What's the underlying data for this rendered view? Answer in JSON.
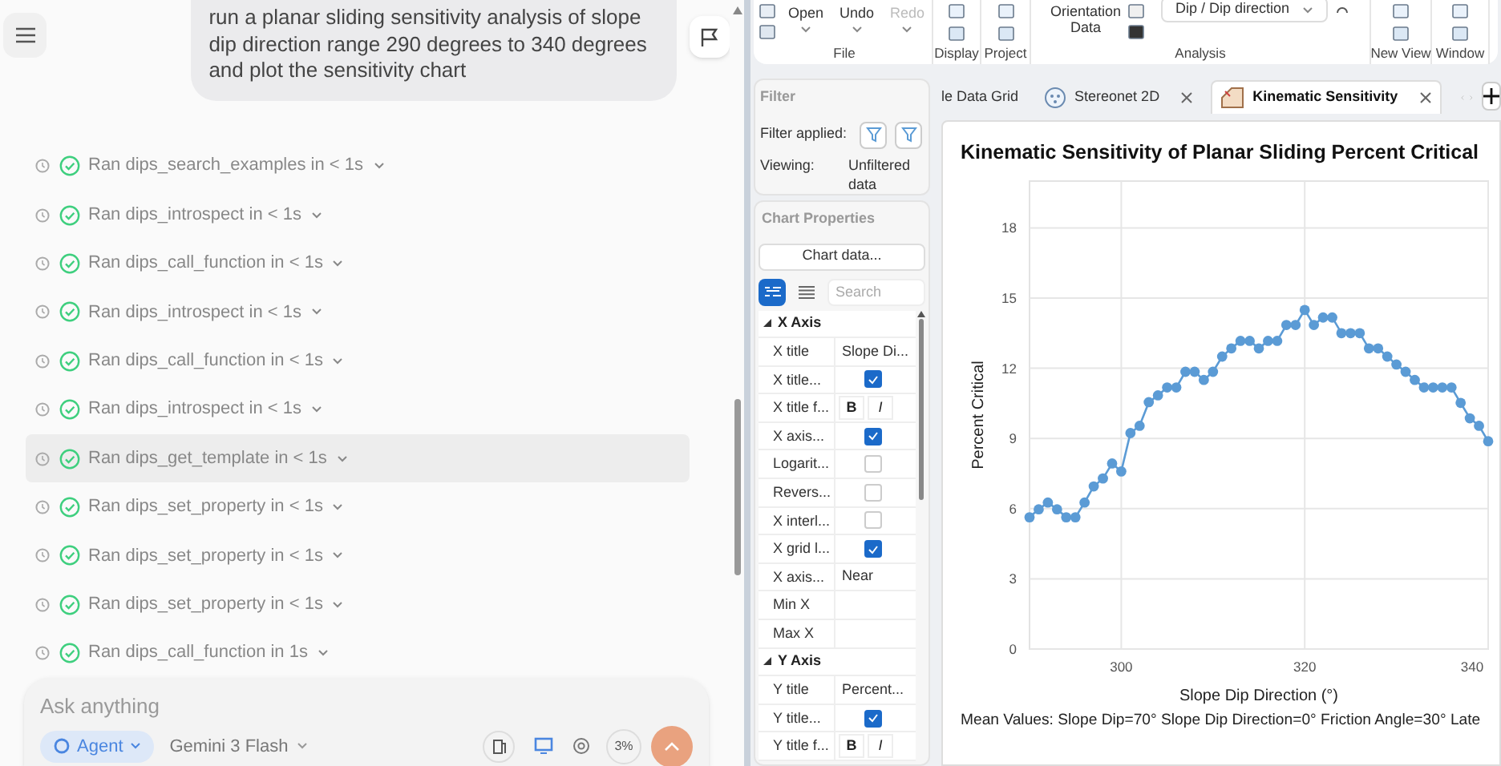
{
  "chat": {
    "user_message": "run a planar sliding sensitivity analysis of slope dip direction range 290 degrees to 340 degrees and plot the sensitivity chart",
    "tool_runs": [
      {
        "text": "Ran dips_search_examples in < 1s",
        "hovered": false
      },
      {
        "text": "Ran dips_introspect in < 1s",
        "hovered": false
      },
      {
        "text": "Ran dips_call_function in < 1s",
        "hovered": false
      },
      {
        "text": "Ran dips_introspect in < 1s",
        "hovered": false
      },
      {
        "text": "Ran dips_call_function in < 1s",
        "hovered": false
      },
      {
        "text": "Ran dips_introspect in < 1s",
        "hovered": false
      },
      {
        "text": "Ran dips_get_template in < 1s",
        "hovered": true
      },
      {
        "text": "Ran dips_set_property in < 1s",
        "hovered": false
      },
      {
        "text": "Ran dips_set_property in < 1s",
        "hovered": false
      },
      {
        "text": "Ran dips_set_property in < 1s",
        "hovered": false
      },
      {
        "text": "Ran dips_call_function in 1s",
        "hovered": false
      }
    ],
    "input": {
      "placeholder": "Ask anything",
      "mode": "Agent",
      "model": "Gemini 3 Flash",
      "context_usage": "3%"
    }
  },
  "ribbon": {
    "groups": [
      {
        "label": "File",
        "items": [
          {
            "label": "Open",
            "disabled": false
          },
          {
            "label": "Undo",
            "disabled": false
          },
          {
            "label": "Redo",
            "disabled": true
          }
        ]
      },
      {
        "label": "Display"
      },
      {
        "label": "Project"
      },
      {
        "label": "Analysis",
        "button": "Orientation Data",
        "select": "Dip / Dip direction"
      },
      {
        "label": "New View"
      },
      {
        "label": "Window"
      }
    ]
  },
  "filter": {
    "title": "Filter",
    "applied_label": "Filter applied:",
    "viewing_label": "Viewing:",
    "viewing_value": "Unfiltered data"
  },
  "chart_properties": {
    "title": "Chart Properties",
    "chart_data_button": "Chart data...",
    "search_placeholder": "Search",
    "view_modes": [
      {
        "kind": "categorized",
        "selected": true
      },
      {
        "kind": "list",
        "selected": false
      }
    ],
    "rows": [
      {
        "kind": "section",
        "label": "X Axis",
        "expanded": true
      },
      {
        "kind": "text",
        "label": "X title",
        "value": "Slope Di..."
      },
      {
        "kind": "checkbox",
        "label": "X title...",
        "checked": true
      },
      {
        "kind": "font",
        "label": "X title f...",
        "bold": "B",
        "italic": "I"
      },
      {
        "kind": "checkbox",
        "label": "X axis...",
        "checked": true
      },
      {
        "kind": "checkbox",
        "label": "Logarit...",
        "checked": false
      },
      {
        "kind": "checkbox",
        "label": "Revers...",
        "checked": false
      },
      {
        "kind": "checkbox",
        "label": "X interl...",
        "checked": false
      },
      {
        "kind": "checkbox",
        "label": "X grid l...",
        "checked": true
      },
      {
        "kind": "text",
        "label": "X axis...",
        "value": "Near"
      },
      {
        "kind": "text",
        "label": "Min X"
      },
      {
        "kind": "text",
        "label": "Max X"
      },
      {
        "kind": "section",
        "label": "Y Axis",
        "expanded": true
      },
      {
        "kind": "text",
        "label": "Y title",
        "value": "Percent..."
      },
      {
        "kind": "checkbox",
        "label": "Y title...",
        "checked": true
      },
      {
        "kind": "font",
        "label": "Y title f...",
        "bold": "B",
        "italic": "I"
      }
    ]
  },
  "tabs": [
    {
      "kind": "grid",
      "label": "le Data Grid",
      "selected": false,
      "closable": false
    },
    {
      "kind": "stereonet",
      "label": "Stereonet 2D",
      "selected": false,
      "closable": true
    },
    {
      "kind": "chart",
      "label": "Kinematic Sensitivity",
      "selected": true,
      "closable": true
    }
  ],
  "chart": {
    "footer": "Mean Values: Slope Dip=70° Slope Dip Direction=0° Friction Angle=30° Late",
    "chart_data": {
      "type": "line",
      "title": "Kinematic Sensitivity of Planar Sliding Percent Critical",
      "xlabel": "Slope Dip Direction (°)",
      "ylabel": "Percent Critical",
      "x": [
        290,
        291,
        292,
        293,
        294,
        295,
        296,
        297,
        298,
        299,
        300,
        301,
        302,
        303,
        304,
        305,
        306,
        307,
        308,
        309,
        310,
        311,
        312,
        313,
        314,
        315,
        316,
        317,
        318,
        319,
        320,
        321,
        322,
        323,
        324,
        325,
        326,
        327,
        328,
        329,
        330,
        331,
        332,
        333,
        334,
        335,
        336,
        337,
        338,
        339,
        340
      ],
      "grid": true,
      "series": [
        {
          "color": "#5b9bd5",
          "marker": "circle",
          "values": [
            5.63,
            5.97,
            6.26,
            5.97,
            5.63,
            5.63,
            6.26,
            6.95,
            7.29,
            7.93,
            7.59,
            9.23,
            9.54,
            10.55,
            10.84,
            11.18,
            11.18,
            11.85,
            11.85,
            11.5,
            11.85,
            12.5,
            12.85,
            13.17,
            13.17,
            12.85,
            13.17,
            13.17,
            13.85,
            13.85,
            14.49,
            13.85,
            14.17,
            14.17,
            13.5,
            13.5,
            13.5,
            12.85,
            12.85,
            12.5,
            12.16,
            11.85,
            11.5,
            11.18,
            11.18,
            11.18,
            11.18,
            10.52,
            9.86,
            9.54,
            8.88
          ]
        }
      ],
      "xlim": [
        290,
        340
      ],
      "ylim": [
        0,
        20
      ],
      "xticks": [
        300,
        320,
        340
      ],
      "yticks": [
        0,
        3,
        6,
        9,
        12,
        15,
        18
      ]
    }
  }
}
